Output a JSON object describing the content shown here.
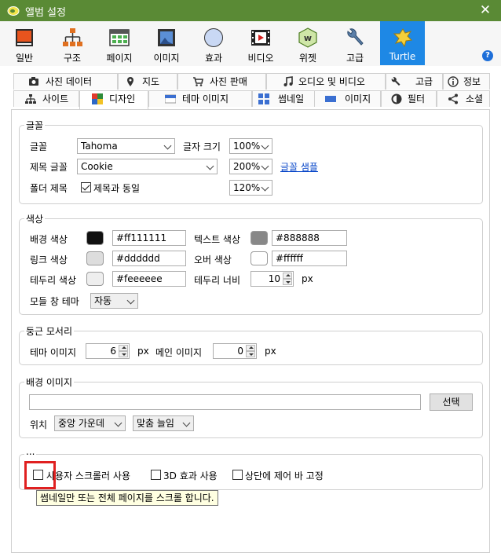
{
  "window": {
    "title": "앨범 설정",
    "close_glyph": "✕",
    "help_glyph": "?"
  },
  "toolbar": [
    {
      "label": "일반",
      "icon": "general-icon"
    },
    {
      "label": "구조",
      "icon": "structure-icon"
    },
    {
      "label": "페이지",
      "icon": "page-icon"
    },
    {
      "label": "이미지",
      "icon": "image-icon"
    },
    {
      "label": "효과",
      "icon": "effects-icon"
    },
    {
      "label": "비디오",
      "icon": "video-icon"
    },
    {
      "label": "위젯",
      "icon": "widget-icon"
    },
    {
      "label": "고급",
      "icon": "advanced-icon"
    },
    {
      "label": "Turtle",
      "icon": "turtle-icon",
      "active": true
    }
  ],
  "tabs_row1": [
    {
      "label": "사진 데이터",
      "icon": "camera-icon"
    },
    {
      "label": "지도",
      "icon": "map-pin-icon"
    },
    {
      "label": "사진 판매",
      "icon": "cart-icon"
    },
    {
      "label": "오디오 및 비디오",
      "icon": "music-icon"
    },
    {
      "label": "고급",
      "icon": "wrench-icon"
    },
    {
      "label": "정보",
      "icon": "info-icon"
    }
  ],
  "tabs_row2": [
    {
      "label": "사이트",
      "icon": "sitemap-icon"
    },
    {
      "label": "디자인",
      "icon": "palette-icon",
      "active": true
    },
    {
      "label": "테마 이미지",
      "icon": "theme-image-icon"
    },
    {
      "label": "썸네일",
      "icon": "grid-icon"
    },
    {
      "label": "이미지",
      "icon": "image-icon"
    },
    {
      "label": "필터",
      "icon": "filter-icon"
    },
    {
      "label": "소셜",
      "icon": "share-icon"
    }
  ],
  "fonts": {
    "legend": "글꼴",
    "font_label": "글꼴",
    "font_value": "Tahoma",
    "font_size_label": "글자 크기",
    "font_size_value": "100%",
    "title_font_label": "제목 글꼴",
    "title_font_value": "Cookie",
    "title_size_value": "200%",
    "sample_link": "글꼴 샘플",
    "folder_title_label": "폴더 제목",
    "same_as_title_label": "제목과 동일",
    "same_as_title_checked": true,
    "folder_size_value": "120%"
  },
  "colors": {
    "legend": "색상",
    "bg_label": "배경 색상",
    "bg_value": "#ff111111",
    "bg_swatch": "#111111",
    "text_label": "텍스트 색상",
    "text_value": "#888888",
    "text_swatch": "#888888",
    "link_label": "링크 색상",
    "link_value": "#dddddd",
    "link_swatch": "#dddddd",
    "hover_label": "오버 색상",
    "hover_value": "#ffffff",
    "hover_swatch": "#ffffff",
    "border_label": "테두리 색상",
    "border_value": "#feeeeee",
    "border_swatch": "#eeeeee",
    "border_width_label": "테두리 너비",
    "border_width_value": "10",
    "border_width_unit": "px",
    "modal_theme_label": "모들 창 테마",
    "modal_theme_value": "자동"
  },
  "corners": {
    "legend": "둥근 모서리",
    "theme_image_label": "테마 이미지",
    "theme_image_value": "6",
    "unit1": "px",
    "main_image_label": "메인 이미지",
    "main_image_value": "0",
    "unit2": "px"
  },
  "background": {
    "legend": "배경 이미지",
    "path_value": "",
    "select_button": "선택",
    "position_label": "위치",
    "position_value": "중앙 가운데",
    "fit_value": "맞춤 늘임"
  },
  "misc": {
    "legend": "...",
    "custom_scroller_label": "사용자 스크롤러 사용",
    "custom_scroller_checked": false,
    "effect_3d_label": "3D 효과 사용",
    "effect_3d_checked": false,
    "fixed_bar_label": "상단에 제어 바 고정",
    "fixed_bar_checked": false
  },
  "tooltip": {
    "text": "썸네일만 또는 전체 페이지를 스크롤 합니다."
  }
}
